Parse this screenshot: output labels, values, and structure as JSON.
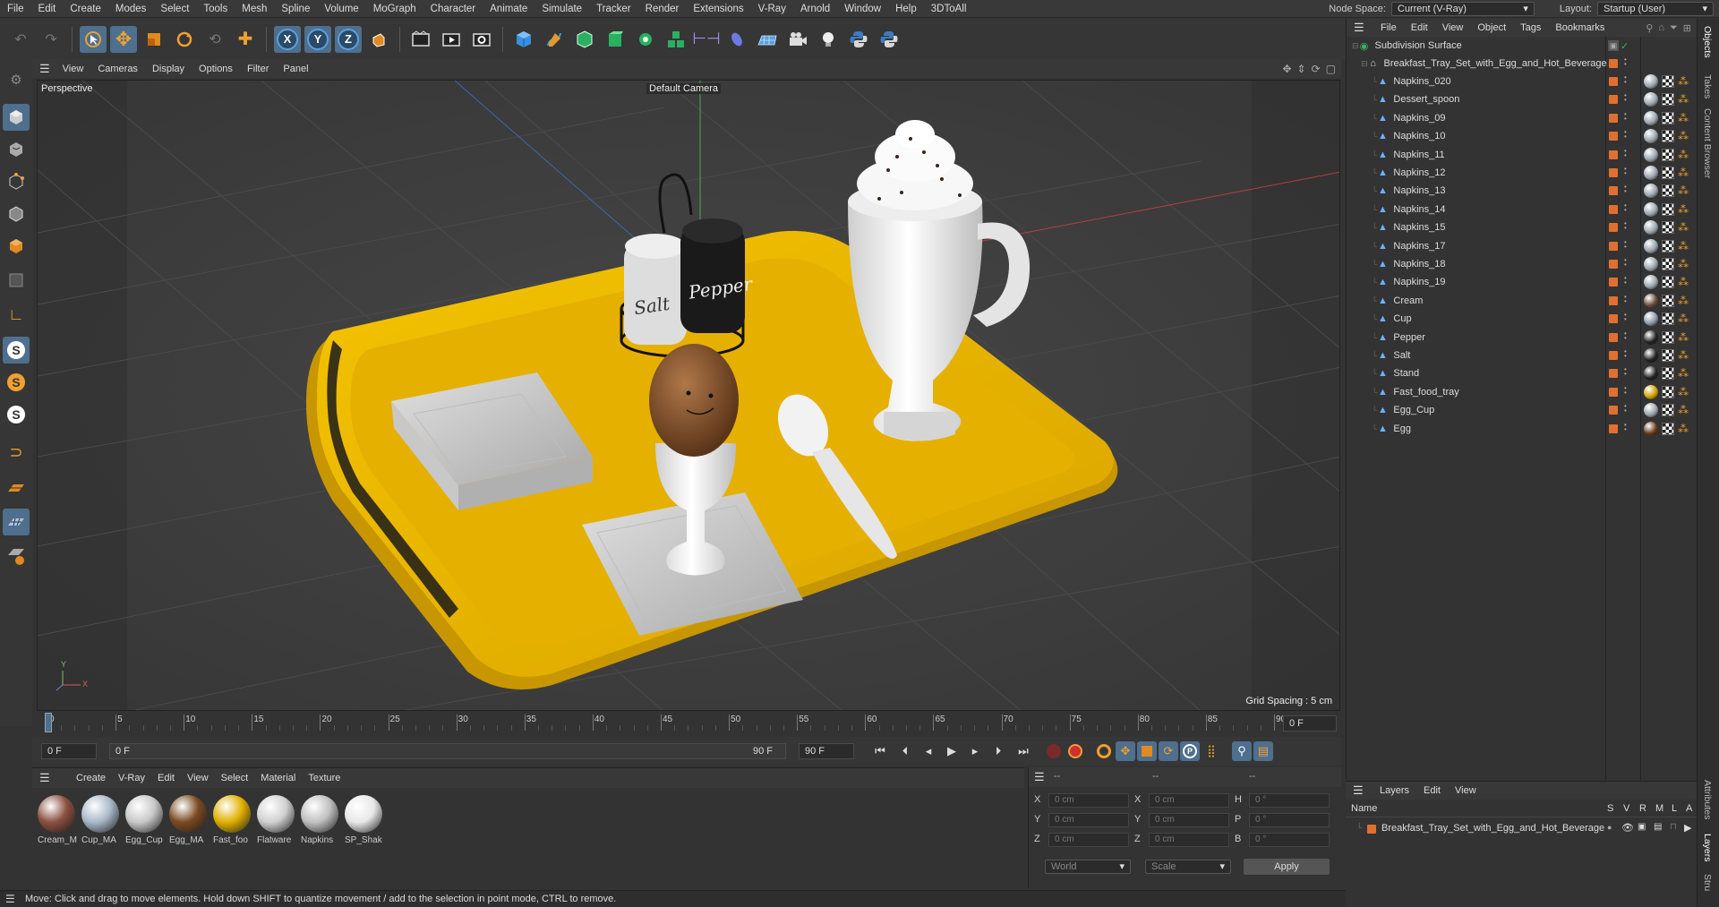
{
  "menubar": {
    "items": [
      "File",
      "Edit",
      "Create",
      "Modes",
      "Select",
      "Tools",
      "Mesh",
      "Spline",
      "Volume",
      "MoGraph",
      "Character",
      "Animate",
      "Simulate",
      "Tracker",
      "Render",
      "Extensions",
      "V-Ray",
      "Arnold",
      "Window",
      "Help",
      "3DToAll"
    ],
    "node_space_label": "Node Space:",
    "node_space_value": "Current (V-Ray)",
    "layout_label": "Layout:",
    "layout_value": "Startup (User)"
  },
  "toolbar": {
    "axis_x": "X",
    "axis_y": "Y",
    "axis_z": "Z"
  },
  "viewport": {
    "menu": [
      "View",
      "Cameras",
      "Display",
      "Options",
      "Filter",
      "Panel"
    ],
    "label": "Perspective",
    "camera": "Default Camera",
    "grid_spacing": "Grid Spacing : 5 cm",
    "axis_y": "Y",
    "axis_x": "X",
    "salt_text": "Salt",
    "pepper_text": "Pepper"
  },
  "timeline": {
    "ticks": [
      "0",
      "5",
      "10",
      "15",
      "20",
      "25",
      "30",
      "35",
      "40",
      "45",
      "50",
      "55",
      "60",
      "65",
      "70",
      "75",
      "80",
      "85",
      "90"
    ],
    "current_frame": "0 F",
    "start_field": "0 F",
    "range_start": "0 F",
    "range_end": "90 F",
    "end_field": "90 F"
  },
  "material_manager": {
    "menu": [
      "Create",
      "V-Ray",
      "Edit",
      "View",
      "Select",
      "Material",
      "Texture"
    ],
    "materials": [
      {
        "label": "Cream_M",
        "color": "#8a5040"
      },
      {
        "label": "Cup_MA",
        "color": "#a8b8c8"
      },
      {
        "label": "Egg_Cup",
        "color": "#c8c8c8"
      },
      {
        "label": "Egg_MA",
        "color": "#7a4a22"
      },
      {
        "label": "Fast_foo",
        "color": "#e0b000"
      },
      {
        "label": "Flatware",
        "color": "#d0d0d0"
      },
      {
        "label": "Napkins",
        "color": "#c0c0c0"
      },
      {
        "label": "SP_Shak",
        "color": "#e8e8e8"
      }
    ]
  },
  "attributes": {
    "header_1": "--",
    "header_2": "--",
    "header_3": "--",
    "rows": [
      {
        "a": "X",
        "av": "0 cm",
        "b": "X",
        "bv": "0 cm",
        "c": "H",
        "cv": "0 °"
      },
      {
        "a": "Y",
        "av": "0 cm",
        "b": "Y",
        "bv": "0 cm",
        "c": "P",
        "cv": "0 °"
      },
      {
        "a": "Z",
        "av": "0 cm",
        "b": "Z",
        "bv": "0 cm",
        "c": "B",
        "cv": "0 °"
      }
    ],
    "world_select": "World",
    "scale_select": "Scale",
    "apply_label": "Apply"
  },
  "statusbar": {
    "text": "Move: Click and drag to move elements. Hold down SHIFT to quantize movement / add to the selection in point mode, CTRL to remove."
  },
  "objects": {
    "menu": [
      "File",
      "Edit",
      "View",
      "Object",
      "Tags",
      "Bookmarks"
    ],
    "root": "Subdivision Surface",
    "group": "Breakfast_Tray_Set_with_Egg_and_Hot_Beverage",
    "items": [
      {
        "name": "Napkins_020",
        "tag": "#9aa3ad"
      },
      {
        "name": "Dessert_spoon",
        "tag": "#9aa3ad"
      },
      {
        "name": "Napkins_09",
        "tag": "#9aa3ad"
      },
      {
        "name": "Napkins_10",
        "tag": "#9aa3ad"
      },
      {
        "name": "Napkins_11",
        "tag": "#9aa3ad"
      },
      {
        "name": "Napkins_12",
        "tag": "#9aa3ad"
      },
      {
        "name": "Napkins_13",
        "tag": "#9aa3ad"
      },
      {
        "name": "Napkins_14",
        "tag": "#9aa3ad"
      },
      {
        "name": "Napkins_15",
        "tag": "#9aa3ad"
      },
      {
        "name": "Napkins_17",
        "tag": "#9aa3ad"
      },
      {
        "name": "Napkins_18",
        "tag": "#9aa3ad"
      },
      {
        "name": "Napkins_19",
        "tag": "#9aa3ad"
      },
      {
        "name": "Cream",
        "tag": "#6a4a3a"
      },
      {
        "name": "Cup",
        "tag": "#8a98a8"
      },
      {
        "name": "Pepper",
        "tag": "#222222"
      },
      {
        "name": "Salt",
        "tag": "#222222"
      },
      {
        "name": "Stand",
        "tag": "#222222"
      },
      {
        "name": "Fast_food_tray",
        "tag": "#d0a000"
      },
      {
        "name": "Egg_Cup",
        "tag": "#9aa3ad"
      },
      {
        "name": "Egg",
        "tag": "#6a3a1a"
      }
    ]
  },
  "layers": {
    "menu": [
      "Layers",
      "Edit",
      "View"
    ],
    "col_name": "Name",
    "cols": [
      "S",
      "V",
      "R",
      "M",
      "L",
      "A"
    ],
    "row": "Breakfast_Tray_Set_with_Egg_and_Hot_Beverage"
  },
  "side_tabs": [
    "Objects",
    "Takes",
    "Content Browser",
    "Attributes",
    "Layers",
    "Stru"
  ]
}
